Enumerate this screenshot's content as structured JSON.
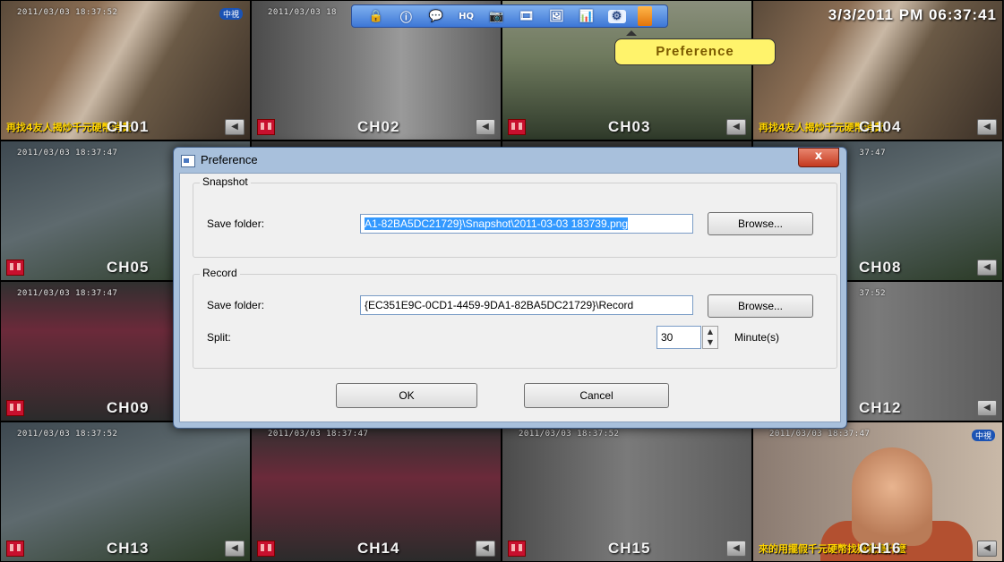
{
  "cameras": [
    {
      "channel": "CH01",
      "timestamp": "2011/03/03 18:37:52",
      "ticker": "再找4友人揭炒千元硬幣消費",
      "logo": "中視"
    },
    {
      "channel": "CH02",
      "timestamp": "2011/03/03 18"
    },
    {
      "channel": "CH03",
      "timestamp": ""
    },
    {
      "channel": "CH04",
      "timestamp": "",
      "ticker": "再找4友人揭炒千元硬幣消費",
      "clock": "3/3/2011 PM 06:37:41"
    },
    {
      "channel": "CH05",
      "timestamp": "2011/03/03 18:37:47"
    },
    {
      "channel": "",
      "timestamp": ""
    },
    {
      "channel": "",
      "timestamp": ""
    },
    {
      "channel": "CH08",
      "timestamp": "37:47"
    },
    {
      "channel": "CH09",
      "timestamp": "2011/03/03 18:37:47"
    },
    {
      "channel": "",
      "timestamp": ""
    },
    {
      "channel": "",
      "timestamp": ""
    },
    {
      "channel": "CH12",
      "timestamp": "37:52"
    },
    {
      "channel": "CH13",
      "timestamp": "2011/03/03 18:37:52"
    },
    {
      "channel": "CH14",
      "timestamp": "2011/03/03 18:37:47"
    },
    {
      "channel": "CH15",
      "timestamp": "2011/03/03 18:37:52"
    },
    {
      "channel": "CH16",
      "timestamp": "2011/03/03 18:37:47",
      "ticker": "來的用擺假千元硬幣找疑犯是什麼",
      "logo": "中視"
    }
  ],
  "toolbar": {
    "buttons": [
      {
        "name": "lock-icon",
        "glyph": "🔒"
      },
      {
        "name": "info-icon",
        "glyph": "ⓘ"
      },
      {
        "name": "chat-icon",
        "glyph": "💬"
      },
      {
        "name": "hq-icon",
        "glyph": "HQ"
      },
      {
        "name": "camera-icon",
        "glyph": "📷"
      },
      {
        "name": "film-icon",
        "glyph": "🎞"
      },
      {
        "name": "image-icon",
        "glyph": "🖼"
      },
      {
        "name": "bar-chart-icon",
        "glyph": "📊"
      },
      {
        "name": "preference-icon",
        "glyph": "⚙"
      }
    ],
    "tooltip": "Preference"
  },
  "dialog": {
    "title": "Preference",
    "close": "x",
    "snapshot": {
      "legend": "Snapshot",
      "label": "Save folder:",
      "value": "A1-82BA5DC21729}\\Snapshot\\2011-03-03 183739.png",
      "browse": "Browse..."
    },
    "record": {
      "legend": "Record",
      "label": "Save folder:",
      "value": "{EC351E9C-0CD1-4459-9DA1-82BA5DC21729}\\Record",
      "browse": "Browse...",
      "split_label": "Split:",
      "split_value": "30",
      "split_unit": "Minute(s)"
    },
    "ok": "OK",
    "cancel": "Cancel"
  },
  "colors": {
    "toolbar": "#3d77d6",
    "tooltip": "#fff36b",
    "dialog_frame": "#a8c0dc",
    "selection": "#3399ff",
    "record_red": "#c8102e"
  }
}
